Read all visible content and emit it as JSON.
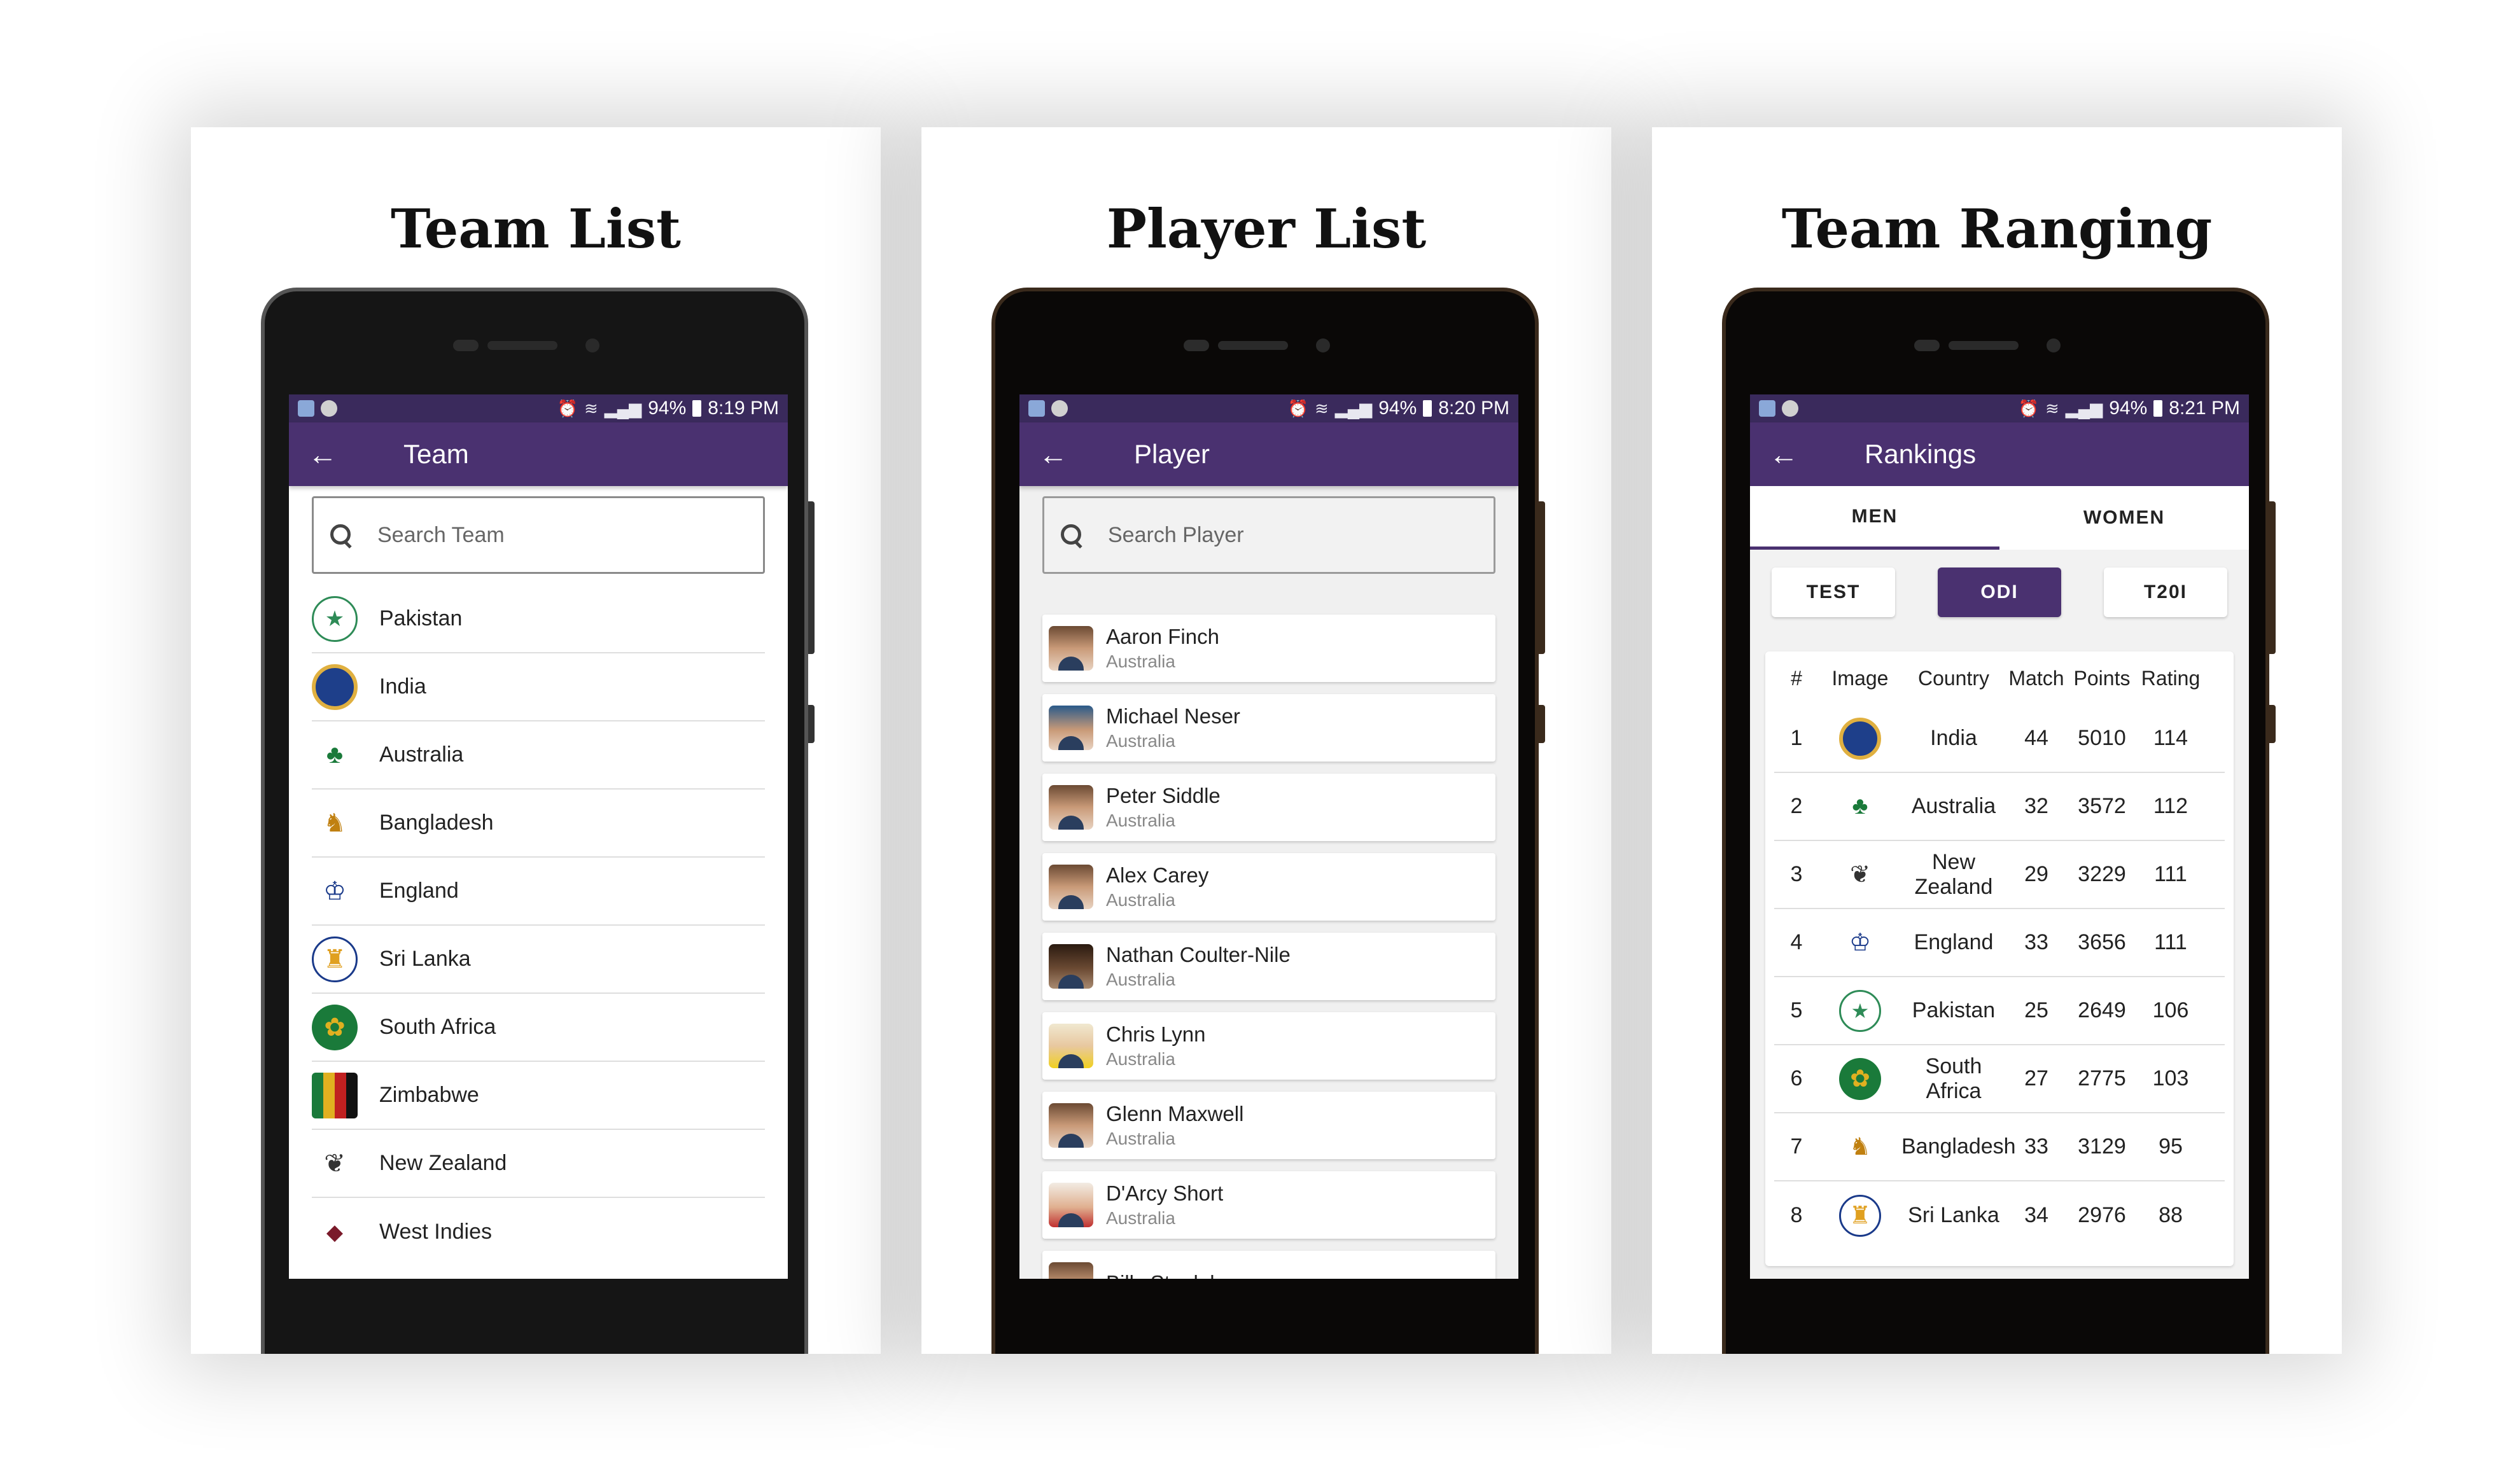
{
  "panels": {
    "team": {
      "title": "Team List",
      "status": {
        "battery": "94%",
        "time": "8:19 PM"
      },
      "appbar_title": "Team",
      "search_placeholder": "Search Team",
      "teams": [
        "Pakistan",
        "India",
        "Australia",
        "Bangladesh",
        "England",
        "Sri Lanka",
        "South Africa",
        "Zimbabwe",
        "New Zealand",
        "West Indies"
      ]
    },
    "player": {
      "title": "Player List",
      "status": {
        "battery": "94%",
        "time": "8:20 PM"
      },
      "appbar_title": "Player",
      "search_placeholder": "Search Player",
      "players": [
        {
          "name": "Aaron Finch",
          "country": "Australia"
        },
        {
          "name": "Michael Neser",
          "country": "Australia"
        },
        {
          "name": "Peter Siddle",
          "country": "Australia"
        },
        {
          "name": "Alex Carey",
          "country": "Australia"
        },
        {
          "name": "Nathan Coulter-Nile",
          "country": "Australia"
        },
        {
          "name": "Chris Lynn",
          "country": "Australia"
        },
        {
          "name": "Glenn Maxwell",
          "country": "Australia"
        },
        {
          "name": "D'Arcy Short",
          "country": "Australia"
        },
        {
          "name": "Billy Stanlake",
          "country": ""
        }
      ]
    },
    "rank": {
      "title": "Team Ranging",
      "status": {
        "battery": "94%",
        "time": "8:21 PM"
      },
      "appbar_title": "Rankings",
      "tabs": [
        "MEN",
        "WOMEN"
      ],
      "formats": [
        "TEST",
        "ODI",
        "T20I"
      ],
      "headers": {
        "num": "#",
        "image": "Image",
        "country": "Country",
        "match": "Match",
        "points": "Points",
        "rating": "Rating"
      },
      "rows": [
        {
          "num": "1",
          "country": "India",
          "match": "44",
          "points": "5010",
          "rating": "114"
        },
        {
          "num": "2",
          "country": "Australia",
          "match": "32",
          "points": "3572",
          "rating": "112"
        },
        {
          "num": "3",
          "country": "New Zealand",
          "match": "29",
          "points": "3229",
          "rating": "111"
        },
        {
          "num": "4",
          "country": "England",
          "match": "33",
          "points": "3656",
          "rating": "111"
        },
        {
          "num": "5",
          "country": "Pakistan",
          "match": "25",
          "points": "2649",
          "rating": "106"
        },
        {
          "num": "6",
          "country": "South Africa",
          "match": "27",
          "points": "2775",
          "rating": "103"
        },
        {
          "num": "7",
          "country": "Bangladesh",
          "match": "33",
          "points": "3129",
          "rating": "95"
        },
        {
          "num": "8",
          "country": "Sri Lanka",
          "match": "34",
          "points": "2976",
          "rating": "88"
        }
      ]
    }
  },
  "colors": {
    "primary": "#4a3170",
    "status_bar": "#3a2a5c"
  }
}
